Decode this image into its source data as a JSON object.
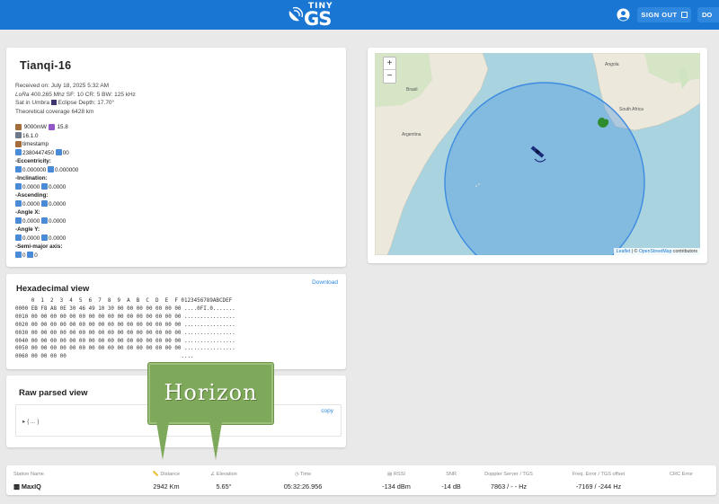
{
  "header": {
    "logo_tiny": "TINY",
    "logo_gs": "GS",
    "sign_out_label": "SIGN OUT",
    "more_label": "DO",
    "brand_color": "#1976d2"
  },
  "satellite": {
    "name": "Tianqi-16",
    "received": "Received on: July 18, 2025 5:32 AM",
    "lora_prefix": "LoRa",
    "modulation": "400.265 Mhz SF: 10 CR: 5 BW: 125 kHz",
    "umbra_text": "Sat in Umbra",
    "eclipse_text": "Eclipse Depth: 17.70°",
    "coverage": "Theoretical coverage 6428 km",
    "power": "9000mW",
    "temp": "15.8",
    "version": "16.1.0",
    "timestamp_label": "timestamp",
    "ts_value_1": "2380447450",
    "ts_value_2": "00",
    "eccentricity_label": "-Eccentricity:",
    "ecc_1": "0.000000",
    "ecc_2": "0.000000",
    "inclination_label": "-Inclination:",
    "inc_1": "0.0000",
    "inc_2": "0.0000",
    "ascending_label": "-Ascending:",
    "asc_1": "0.0000",
    "asc_2": "0.0000",
    "anglex_label": "-Angle X:",
    "ax_1": "0.0000",
    "ax_2": "0.0000",
    "angley_label": "-Angle Y:",
    "ay_1": "0.0000",
    "ay_2": "0.0000",
    "semimajor_label": "-Semi-major axis:",
    "sm_1": "0",
    "sm_2": "0"
  },
  "map": {
    "zoom_in": "+",
    "zoom_out": "−",
    "attrib_leaflet": "Leaflet",
    "attrib_sep": " | © ",
    "attrib_osm": "OpenStreetMap",
    "attrib_rest": " contributors",
    "label_brasil": "Brasil",
    "label_argentina": "Argentina",
    "label_angola": "Angola",
    "label_africa": "South Africa",
    "coverage_color": "#3d8be0"
  },
  "hex": {
    "title": "Hexadecimal view",
    "download": "Download",
    "lines": [
      "     0  1  2  3  4  5  6  7  8  9  A  B  C  D  E  F 0123456789ABCDEF",
      "0000 EB F8 A8 0E 30 46 49 10 30 00 00 00 00 00 00 00 ....0FI.0.......",
      "0010 00 00 00 00 00 00 00 00 00 00 00 00 00 00 00 00 ................",
      "0020 00 00 00 00 00 00 00 00 00 00 00 00 00 00 00 00 ................",
      "0030 00 00 00 00 00 00 00 00 00 00 00 00 00 00 00 00 ................",
      "0040 00 00 00 00 00 00 00 00 00 00 00 00 00 00 00 00 ................",
      "0050 00 00 00 00 00 00 00 00 00 00 00 00 00 00 00 00 ................",
      "0060 00 00 00 00                                    ...."
    ]
  },
  "raw": {
    "title": "Raw parsed view",
    "copy": "copy",
    "tree": "▸ { ... }"
  },
  "table": {
    "station_name_h": "Station Name",
    "distance_h": "Distance",
    "elevation_h": "Elevation",
    "time_h": "Time",
    "rssi_h": "RSSI",
    "snr_h": "SNR",
    "doppler_h": "Doppler Server / TGS",
    "freq_h": "Freq. Error / TGS offset",
    "crc_h": "CRC Error",
    "station": "MaxIQ",
    "distance": "2942 Km",
    "elevation": "5.65°",
    "time": "05:32:26.956",
    "rssi": "-134 dBm",
    "snr": "-14 dB",
    "doppler": "7863 / - - Hz",
    "freq": "-7169 / -244 Hz"
  },
  "callout": {
    "text": "Horizon",
    "color": "#7ea85a"
  }
}
